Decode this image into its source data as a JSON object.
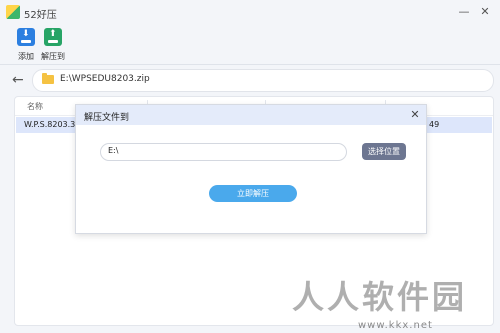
{
  "app": {
    "title": "52好压"
  },
  "toolbar": {
    "add_label": "添加",
    "extract_to_label": "解压到"
  },
  "path_bar": {
    "path": "E:\\WPSEDU8203.zip"
  },
  "file_list": {
    "columns": [
      "名称"
    ],
    "rows": [
      {
        "name": "W.P.S.8203.30",
        "tail": "49"
      }
    ]
  },
  "dialog": {
    "title": "解压文件到",
    "destination": "E:\\",
    "browse_label": "选择位置",
    "extract_label": "立即解压"
  },
  "watermark": {
    "text": "人人软件园",
    "url": "www.kkx.net"
  },
  "colors": {
    "accent_blue": "#4aa9ec",
    "add_icon": "#2c7fe0",
    "extract_icon": "#27a466",
    "browse_button": "#6d7691",
    "dialog_header": "#e4ebfa",
    "selected_row": "#dde6fb"
  },
  "icons": [
    "app-logo-icon",
    "minimize-icon",
    "close-icon",
    "add-icon",
    "extract-icon",
    "back-arrow-icon",
    "folder-icon"
  ]
}
